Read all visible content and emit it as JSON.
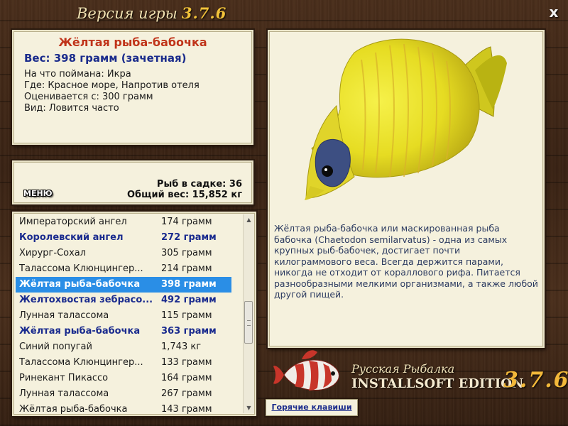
{
  "header": {
    "version_label": "Версия игры",
    "version_number": "3.7.6",
    "close_label": "x"
  },
  "fish_info": {
    "name": "Жёлтая рыба-бабочка",
    "weight_line": "Вес: 398 грамм (зачетная)",
    "lines": [
      "На что поймана: Икра",
      "Где: Красное море, Напротив отеля",
      "Оценивается с: 300 грамм",
      "Вид: Ловится часто"
    ]
  },
  "stats": {
    "menu_label": "МЕНЮ",
    "fish_count": "Рыб в садке: 36",
    "total_weight": "Общий вес: 15,852 кг"
  },
  "catch_list": [
    {
      "name": "Императорский ангел",
      "weight": "174 грамм",
      "trophy": false,
      "selected": false
    },
    {
      "name": "Королевский ангел",
      "weight": "272 грамм",
      "trophy": true,
      "selected": false
    },
    {
      "name": "Хирург-Сохал",
      "weight": "305 грамм",
      "trophy": false,
      "selected": false
    },
    {
      "name": "Талассома Клюнцингер...",
      "weight": "214 грамм",
      "trophy": false,
      "selected": false
    },
    {
      "name": "Жёлтая рыба-бабочка",
      "weight": "398 грамм",
      "trophy": true,
      "selected": true
    },
    {
      "name": "Желтохвостая зебрасо...",
      "weight": "492 грамм",
      "trophy": true,
      "selected": false
    },
    {
      "name": "Лунная талассома",
      "weight": "115 грамм",
      "trophy": false,
      "selected": false
    },
    {
      "name": "Жёлтая рыба-бабочка",
      "weight": "363 грамм",
      "trophy": true,
      "selected": false
    },
    {
      "name": "Синий попугай",
      "weight": "1,743 кг",
      "trophy": false,
      "selected": false
    },
    {
      "name": "Талассома Клюнцингер...",
      "weight": "133 грамм",
      "trophy": false,
      "selected": false
    },
    {
      "name": "Ринекант Пикассо",
      "weight": "164 грамм",
      "trophy": false,
      "selected": false
    },
    {
      "name": "Лунная талассома",
      "weight": "267 грамм",
      "trophy": false,
      "selected": false
    },
    {
      "name": "Жёлтая рыба-бабочка",
      "weight": "143 грамм",
      "trophy": false,
      "selected": false
    }
  ],
  "description": "Жёлтая рыба-бабочка или маскированная рыба бабочка (Chaetodon semilarvatus) - одна из самых крупных рыб-бабочек, достигает почти килограммового веса. Всегда держится парами, никогда не отходит от кораллового рифа. Питается разнообразными мелкими организмами, а также любой другой пищей.",
  "brand": {
    "subtitle": "Русская Рыбалка",
    "title": "INSTALLSOFT EDITION",
    "version": "3.7.6"
  },
  "hotkeys_label": "Горячие клавиши",
  "colors": {
    "selected_row": "#2a8ee6",
    "trophy_text": "#1a2b8e",
    "fish_name": "#c0341a",
    "panel_bg": "#f5f1dd"
  }
}
